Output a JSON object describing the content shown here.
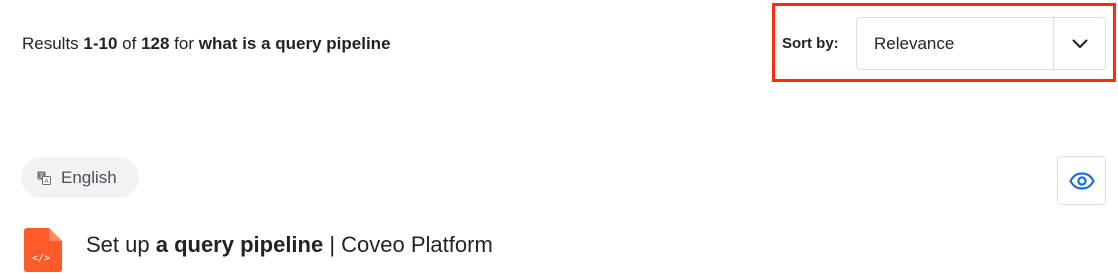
{
  "summary": {
    "prefix": "Results ",
    "range": "1-10",
    "of_text": " of ",
    "total": "128",
    "for_text": " for ",
    "query": "what is a query pipeline"
  },
  "sort": {
    "label": "Sort by:",
    "selected": "Relevance",
    "highlight_color": "#ff2a0c"
  },
  "language": {
    "label": "English",
    "icon": "translate-icon"
  },
  "quickview": {
    "icon": "eye-icon",
    "color": "#1b6fd8"
  },
  "result": {
    "file_icon": "code-file-icon",
    "file_icon_color": "#ff5a2a",
    "title_prefix": "Set up ",
    "title_highlight": "a query pipeline",
    "title_suffix": " | Coveo Platform"
  }
}
